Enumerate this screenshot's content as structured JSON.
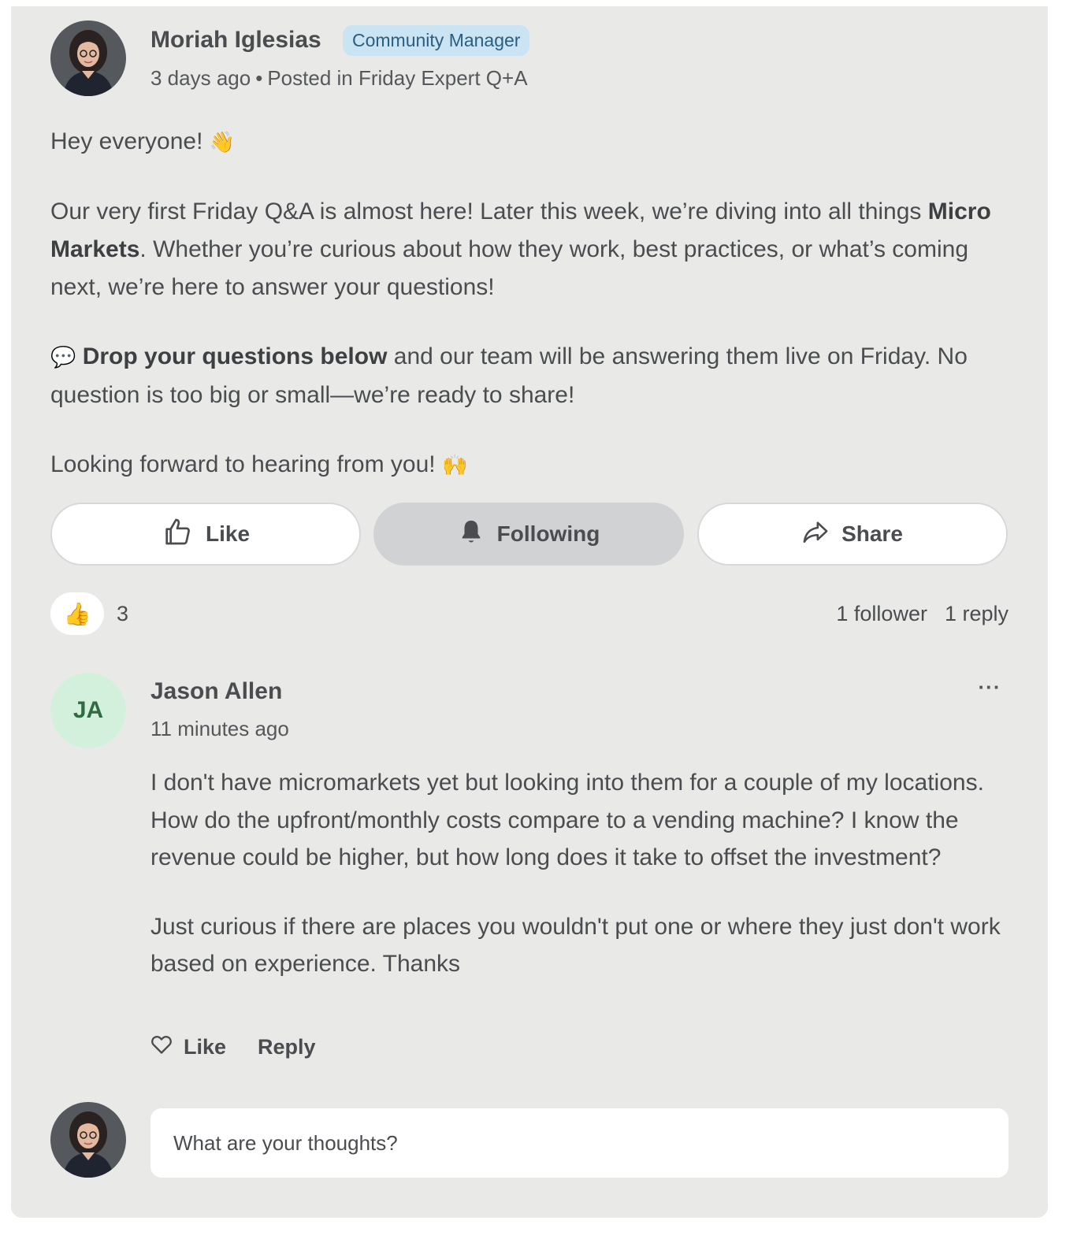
{
  "post": {
    "author": "Moriah Iglesias",
    "badge": "Community Manager",
    "time": "3 days ago",
    "separator": "•",
    "posted_in": "Posted in Friday Expert Q+A",
    "greeting": "Hey everyone!",
    "greeting_emoji": "👋",
    "para1_a": "Our very first Friday Q&A is almost here! Later this week, we’re diving into all things ",
    "para1_bold": "Micro Markets",
    "para1_b": ". Whether you’re curious about how they work, best practices, or what’s coming next, we’re here to answer your questions!",
    "para2_emoji": "💬",
    "para2_bold": "Drop your questions below",
    "para2_rest": " and our team will be answering them live on Friday. No question is too big or small—we’re ready to share!",
    "closing": "Looking forward to hearing from you!",
    "closing_emoji": "🙌"
  },
  "actions": {
    "like": "Like",
    "following": "Following",
    "share": "Share"
  },
  "stats": {
    "reaction_emoji": "👍",
    "reaction_count": "3",
    "followers": "1 follower",
    "replies": "1 reply"
  },
  "reply": {
    "initials": "JA",
    "author": "Jason Allen",
    "time": "11 minutes ago",
    "more": "···",
    "para1": "I don't have micromarkets yet but looking into them for a couple of my locations. How do the upfront/monthly costs compare to a vending machine? I know the revenue could be higher, but how long does it take to offset the investment?",
    "para2": "Just curious if there are places you wouldn't put one or where they just don't work based on experience. Thanks",
    "like": "Like",
    "reply": "Reply"
  },
  "composer": {
    "placeholder": "What are your thoughts?"
  },
  "icons": {
    "like_icon": "thumbs-up-icon",
    "following_icon": "bell-icon",
    "share_icon": "share-arrow-icon",
    "reply_like_icon": "heart-icon"
  },
  "colors": {
    "card_bg": "#e9eae8",
    "badge_bg": "#cbe4f3",
    "badge_text": "#2b5e80",
    "following_bg": "#d1d2d3",
    "ja_avatar_bg": "#d3f0dc",
    "ja_avatar_text": "#2f6b43"
  }
}
